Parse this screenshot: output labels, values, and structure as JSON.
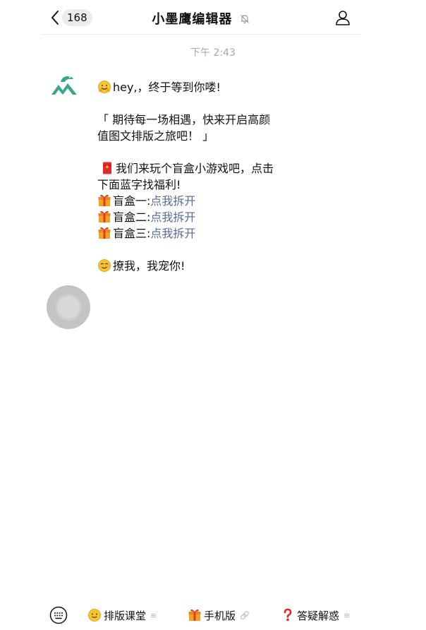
{
  "header": {
    "unread_count": "168",
    "title": "小墨鹰编辑器"
  },
  "time": "下午 2:43",
  "message": {
    "greeting": "hey,，终于等到你喽!",
    "quote_line1": "「 期待每一场相遇，快来开启高颜",
    "quote_line2": " 值图文排版之旅吧！ 」",
    "game_line1": "我们来玩个盲盒小游戏吧，点击",
    "game_line2": "下面蓝字找福利!",
    "boxes": [
      {
        "label": "盲盒一:",
        "link": "点我拆开"
      },
      {
        "label": "盲盒二:",
        "link": "点我拆开"
      },
      {
        "label": "盲盒三:",
        "link": "点我拆开"
      }
    ],
    "closing": "撩我，我宠你!"
  },
  "bottom_menu": {
    "items": [
      {
        "label": "排版课堂",
        "icon": "smile-emoji-icon",
        "suffix": "≡"
      },
      {
        "label": "手机版",
        "icon": "gift-emoji-icon",
        "suffix": "🔗"
      },
      {
        "label": "答疑解惑",
        "icon": "question-mark-icon",
        "suffix": "≡"
      }
    ]
  },
  "colors": {
    "link": "#576b95",
    "brand_logo": "#3aa589",
    "time_gray": "#a9a9a9"
  }
}
